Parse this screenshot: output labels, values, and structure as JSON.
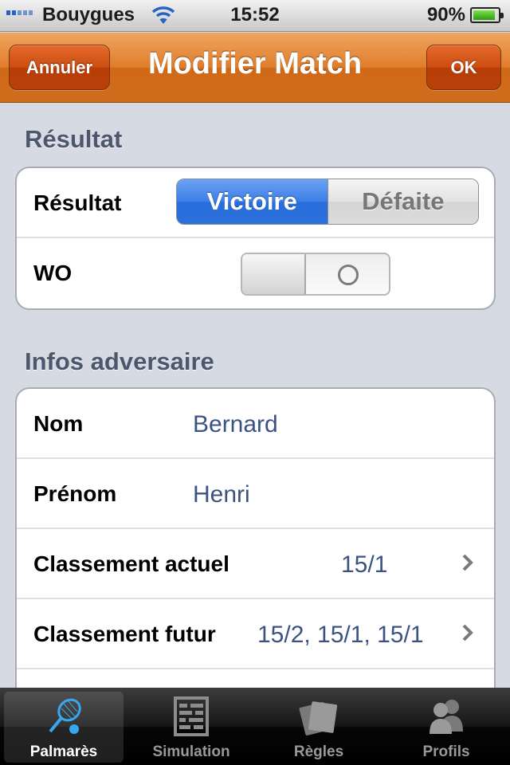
{
  "status_bar": {
    "carrier": "Bouygues",
    "time": "15:52",
    "battery": "90%",
    "battery_level": 0.9,
    "signal_icon": "signal-bars-icon",
    "wifi_icon": "wifi-icon"
  },
  "nav": {
    "title": "Modifier Match",
    "cancel_label": "Annuler",
    "ok_label": "OK"
  },
  "result_section": {
    "header": "Résultat",
    "result_label": "Résultat",
    "segments": [
      "Victoire",
      "Défaite"
    ],
    "selected_segment": "Victoire",
    "wo_label": "WO",
    "wo_on": false
  },
  "opponent_section": {
    "header": "Infos adversaire",
    "rows": [
      {
        "label": "Nom",
        "value": "Bernard"
      },
      {
        "label": "Prénom",
        "value": "Henri"
      },
      {
        "label": "Classement actuel",
        "value": "15/1"
      },
      {
        "label": "Classement futur",
        "value": "15/2, 15/1, 15/1"
      }
    ]
  },
  "tab_bar": {
    "tabs": [
      {
        "label": "Palmarès",
        "icon": "tennis-racket-icon",
        "active": true
      },
      {
        "label": "Simulation",
        "icon": "abacus-icon",
        "active": false
      },
      {
        "label": "Règles",
        "icon": "cards-icon",
        "active": false
      },
      {
        "label": "Profils",
        "icon": "users-icon",
        "active": false
      }
    ]
  },
  "colors": {
    "nav_orange": "#df7d2b",
    "value_blue": "#3a5380",
    "segment_blue": "#3c7ee6",
    "background": "#d6dbe3"
  }
}
